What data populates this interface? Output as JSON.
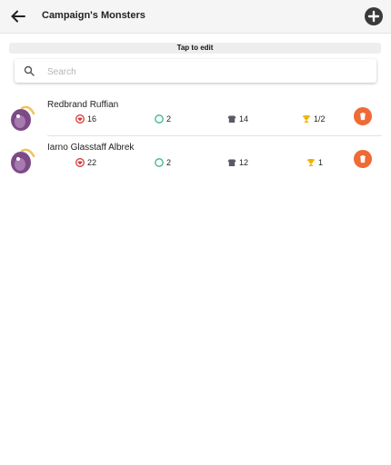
{
  "appbar": {
    "title": "Campaign's Monsters"
  },
  "tap_to_edit": "Tap to edit",
  "search": {
    "placeholder": "Search",
    "value": ""
  },
  "monsters": [
    {
      "name": "Redbrand Ruffian",
      "hp": "16",
      "initiative": "2",
      "ac": "14",
      "cr": "1/2"
    },
    {
      "name": "Iarno Glasstaff Albrek",
      "hp": "22",
      "initiative": "2",
      "ac": "12",
      "cr": "1"
    }
  ],
  "colors": {
    "delete": "#ef6a35",
    "hp_icon": "#d63a3a",
    "init_icon": "#3bb38a",
    "trophy": "#f0b400"
  }
}
